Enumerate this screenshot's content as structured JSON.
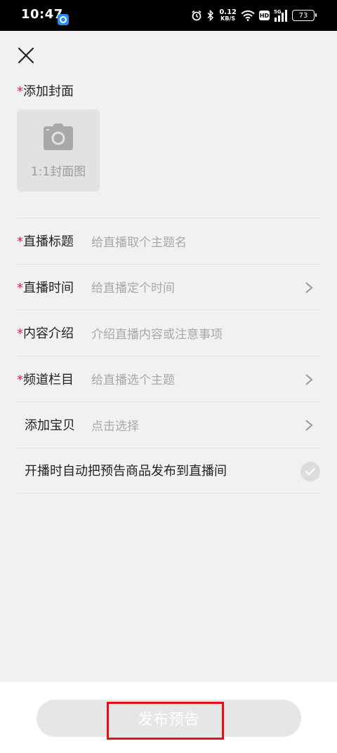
{
  "status_bar": {
    "time": "10:47",
    "speed_value": "0.12",
    "speed_unit": "KB/S",
    "hd": "HD",
    "network": "5G",
    "battery": "73"
  },
  "header": {
    "close_icon": "close-icon"
  },
  "cover": {
    "required_mark": "*",
    "title": "添加封面",
    "placeholder": "1:1封面图",
    "icon": "camera-icon"
  },
  "form": {
    "title_row": {
      "required_mark": "*",
      "label": "直播标题",
      "placeholder": "给直播取个主题名"
    },
    "time_row": {
      "required_mark": "*",
      "label": "直播时间",
      "placeholder": "给直播定个时间"
    },
    "intro_row": {
      "required_mark": "*",
      "label": "内容介绍",
      "placeholder": "介绍直播内容或注意事项"
    },
    "channel_row": {
      "required_mark": "*",
      "label": "频道栏目",
      "placeholder": "给直播选个主题"
    },
    "goods_row": {
      "label": "添加宝贝",
      "placeholder": "点击选择"
    },
    "auto_publish_row": {
      "label": "开播时自动把预告商品发布到直播间",
      "checked": false
    }
  },
  "footer": {
    "publish_label": "发布预告"
  },
  "colors": {
    "required": "#d6244f",
    "highlight": "#e3101a",
    "button_disabled": "#e6e6e6"
  }
}
